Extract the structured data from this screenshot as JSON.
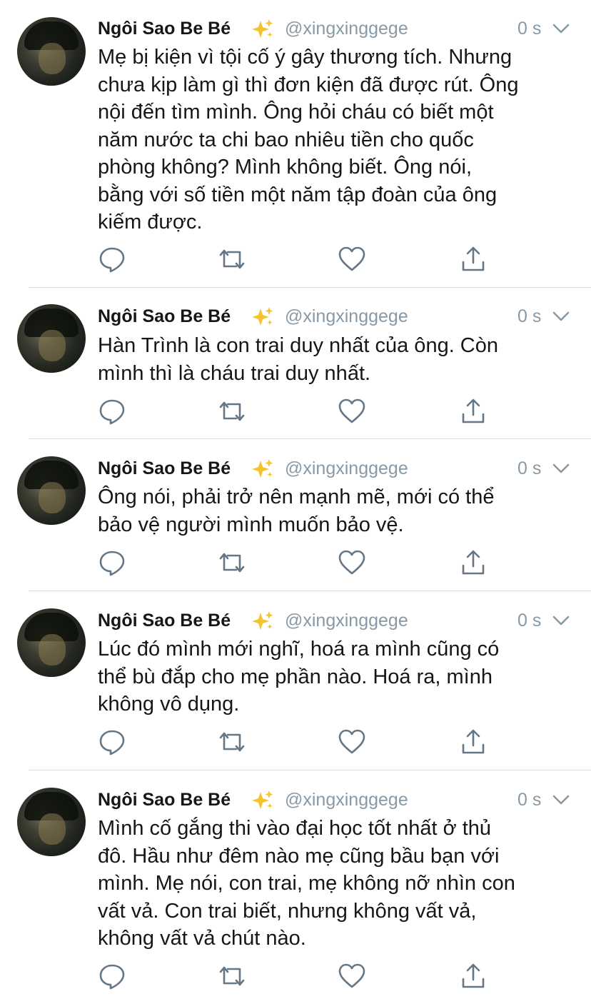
{
  "tweets": [
    {
      "name": "Ngôi Sao Be Bé",
      "handle": "@xingxinggege",
      "time": "0 s",
      "lines": [
        "Mẹ bị kiện vì tội cố ý gây thương tích. Nhưng",
        "chưa kịp làm gì thì đơn kiện đã được rút. Ông",
        "nội đến tìm mình. Ông hỏi cháu có biết một",
        "năm nước ta chi bao nhiêu tiền cho quốc",
        "phòng không? Mình không biết. Ông nói,",
        "bằng với số tiền một năm tập đoàn của ông",
        "kiếm được."
      ]
    },
    {
      "name": "Ngôi Sao Be Bé",
      "handle": "@xingxinggege",
      "time": "0 s",
      "lines": [
        "Hàn Trình là con trai duy nhất của ông. Còn",
        "mình thì là cháu trai duy nhất."
      ]
    },
    {
      "name": "Ngôi Sao Be Bé",
      "handle": "@xingxinggege",
      "time": "0 s",
      "lines": [
        "Ông nói, phải trở nên mạnh mẽ, mới có thể",
        "bảo vệ người mình muốn bảo vệ."
      ]
    },
    {
      "name": "Ngôi Sao Be Bé",
      "handle": "@xingxinggege",
      "time": "0 s",
      "lines": [
        "Lúc đó mình mới nghĩ, hoá ra mình cũng có",
        "thể bù đắp cho mẹ phần nào. Hoá ra, mình",
        "không vô dụng."
      ]
    },
    {
      "name": "Ngôi Sao Be Bé",
      "handle": "@xingxinggege",
      "time": "0 s",
      "lines": [
        "Mình cố gắng thi vào đại học tốt nhất ở thủ",
        "đô. Hầu như đêm nào mẹ cũng bầu bạn với",
        "mình. Mẹ nói, con trai, mẹ không nỡ nhìn con",
        "vất vả. Con trai biết, nhưng không vất vả,",
        "không vất vả chút nào."
      ]
    }
  ],
  "icons": {
    "reply": "reply-icon",
    "retweet": "retweet-icon",
    "like": "heart-icon",
    "share": "share-icon",
    "menu": "chevron-down-icon",
    "emoji": "sparkles-icon"
  },
  "colors": {
    "icon_gray": "#657786",
    "handle_gray": "#8899a6",
    "sparkle": "#f5c42c",
    "divider": "#d8dde1"
  }
}
